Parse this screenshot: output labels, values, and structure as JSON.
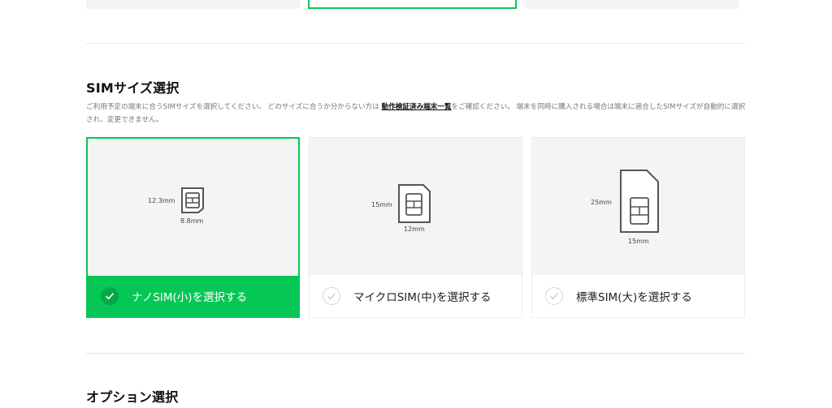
{
  "sim_size": {
    "title": "SIMサイズ選択",
    "description_before": "ご利用予定の端末に合うSIMサイズを選択してください。 どのサイズに合うか分からない方は ",
    "description_link": "動作検証済み端末一覧",
    "description_after": "をご確認ください。 端末を同時に購入される場合は端末に適合したSIMサイズが自動的に選択され、変更できません。",
    "options": [
      {
        "label": "ナノSIM(小)を選択する",
        "height_dim": "12.3mm",
        "width_dim": "8.8mm",
        "selected": true
      },
      {
        "label": "マイクロSIM(中)を選択する",
        "height_dim": "15mm",
        "width_dim": "12mm",
        "selected": false
      },
      {
        "label": "標準SIM(大)を選択する",
        "height_dim": "25mm",
        "width_dim": "15mm",
        "selected": false
      }
    ]
  },
  "option_section": {
    "title": "オプション選択"
  },
  "colors": {
    "accent": "#06c755",
    "card_bg": "#f3f4f5",
    "text_muted": "#777777"
  },
  "icons": {
    "check": "check-icon",
    "sim": "sim-card-icon"
  }
}
